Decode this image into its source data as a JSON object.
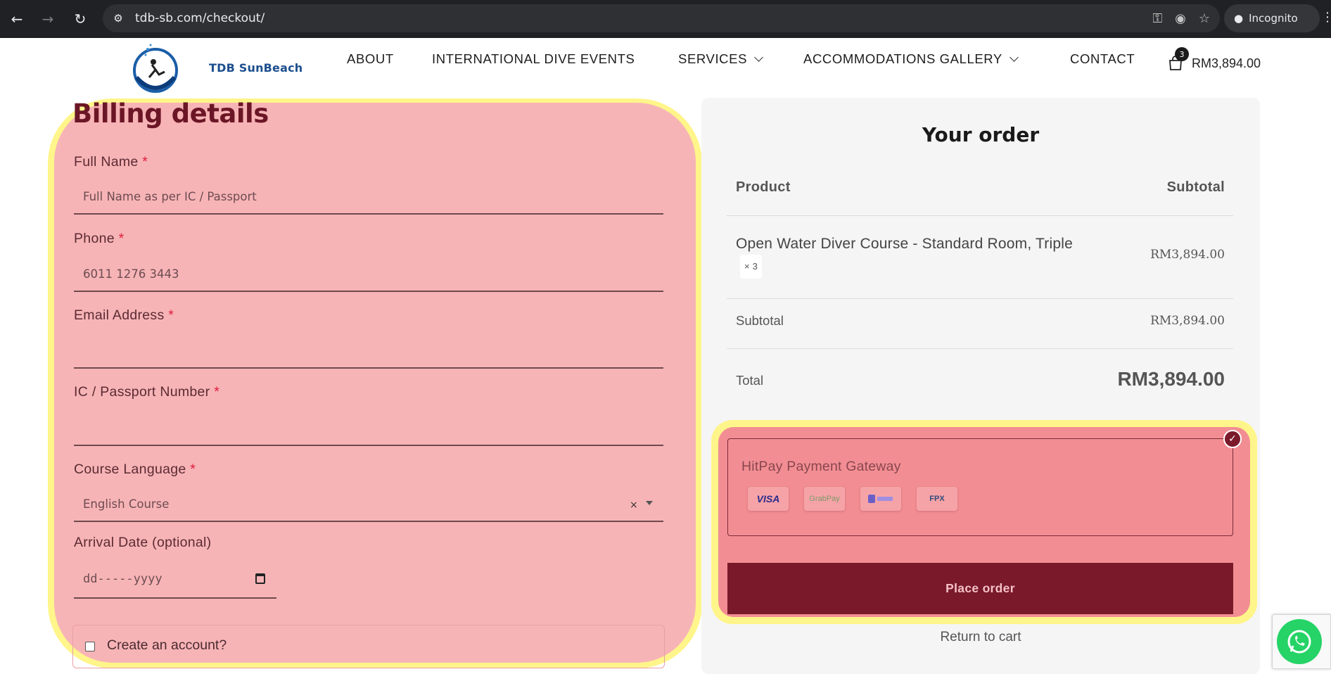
{
  "browser": {
    "url": "tdb-sb.com/checkout/",
    "incognito_label": "Incognito"
  },
  "site": {
    "brand": "TDB SunBeach",
    "menu": [
      {
        "label": "ABOUT",
        "has_dropdown": false
      },
      {
        "label": "INTERNATIONAL DIVE EVENTS",
        "has_dropdown": false
      },
      {
        "label": "SERVICES",
        "has_dropdown": true
      },
      {
        "label": "ACCOMMODATIONS GALLERY",
        "has_dropdown": true
      },
      {
        "label": "CONTACT",
        "has_dropdown": false
      }
    ],
    "cart": {
      "count": "3",
      "total": "RM3,894.00"
    }
  },
  "billing": {
    "title": "Billing details",
    "required_mark": "*",
    "full_name": {
      "label": "Full Name",
      "placeholder": "Full Name as per IC / Passport"
    },
    "phone": {
      "label": "Phone",
      "value": "6011 1276 3443"
    },
    "email": {
      "label": "Email Address",
      "value": ""
    },
    "ic_passport": {
      "label": "IC / Passport Number",
      "value": ""
    },
    "course_language": {
      "label": "Course Language",
      "value": "English Course",
      "clear_glyph": "×"
    },
    "arrival_date": {
      "label": "Arrival Date (optional)",
      "placeholder": "dd-----yyyy"
    },
    "create_account": {
      "label": "Create an account?",
      "checked": false
    }
  },
  "order": {
    "title": "Your order",
    "col_product": "Product",
    "col_subtotal": "Subtotal",
    "item": {
      "name": "Open Water Diver Course - Standard Room, Triple",
      "qty": "× 3",
      "amount": "RM3,894.00"
    },
    "subtotal_label": "Subtotal",
    "subtotal_value": "RM3,894.00",
    "total_label": "Total",
    "total_value": "RM3,894.00"
  },
  "payment": {
    "gateway_name": "HitPay Payment Gateway",
    "selected": true,
    "logos": [
      {
        "name": "VISA",
        "color": "#2a2a8a"
      },
      {
        "name": "GrabPay",
        "color": "#7d9a6a"
      },
      {
        "name": "ShopeePay",
        "color": "#6b5fc7"
      },
      {
        "name": "FPX",
        "color": "#2d4a7a"
      }
    ],
    "place_order_label": "Place order",
    "return_to_cart_label": "Return to cart"
  },
  "colors": {
    "highlight_yellow": "#fff58a",
    "billing_pink": "#f7b4b6",
    "payment_pink": "#f28e93",
    "brand_maroon": "#79192a"
  }
}
